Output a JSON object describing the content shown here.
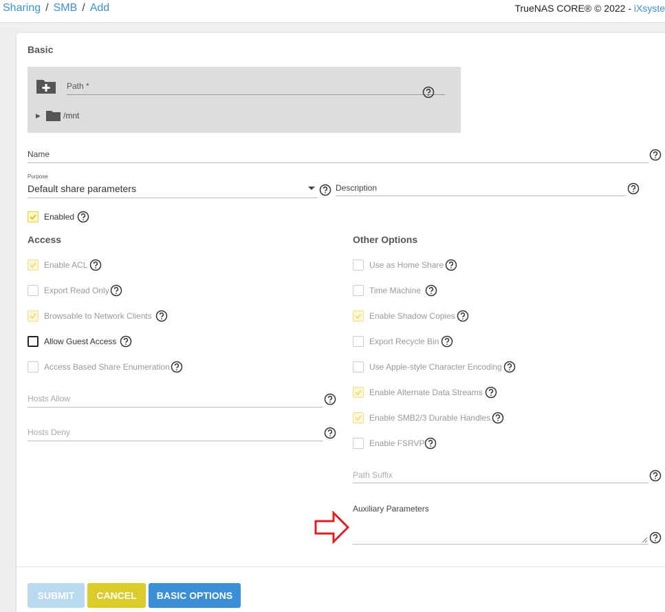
{
  "breadcrumb": {
    "items": [
      "Sharing",
      "SMB",
      "Add"
    ],
    "separator": "/"
  },
  "copyright": {
    "text": "TrueNAS CORE® © 2022 - ",
    "brand": "iXsyste"
  },
  "basic": {
    "title": "Basic",
    "path_label": "Path *",
    "tree_root": "/mnt",
    "name_label": "Name",
    "purpose_label": "Purpose",
    "purpose_value": "Default share parameters",
    "description_label": "Description",
    "enabled_label": "Enabled"
  },
  "access": {
    "title": "Access",
    "options": [
      {
        "label": "Enable ACL",
        "checked": true
      },
      {
        "label": "Export Read Only",
        "checked": false
      },
      {
        "label": "Browsable to Network Clients",
        "checked": true
      },
      {
        "label": "Allow Guest Access",
        "checked": false
      },
      {
        "label": "Access Based Share Enumeration",
        "checked": false
      }
    ],
    "hosts_allow_label": "Hosts Allow",
    "hosts_deny_label": "Hosts Deny"
  },
  "other": {
    "title": "Other Options",
    "options": [
      {
        "label": "Use as Home Share",
        "checked": false
      },
      {
        "label": "Time Machine",
        "checked": false
      },
      {
        "label": "Enable Shadow Copies",
        "checked": true
      },
      {
        "label": "Export Recycle Bin",
        "checked": false
      },
      {
        "label": "Use Apple-style Character Encoding",
        "checked": false
      },
      {
        "label": "Enable Alternate Data Streams",
        "checked": true
      },
      {
        "label": "Enable SMB2/3 Durable Handles",
        "checked": true
      },
      {
        "label": "Enable FSRVP",
        "checked": false
      }
    ],
    "path_suffix_label": "Path Suffix",
    "aux_label": "Auxiliary Parameters"
  },
  "buttons": {
    "submit": "SUBMIT",
    "cancel": "CANCEL",
    "basic_options": "BASIC OPTIONS"
  },
  "colors": {
    "accent": "#3b8fd6",
    "check": "#e5d33a",
    "cancel": "#dccc2a",
    "annotation_arrow": "#e02020"
  },
  "icons": [
    "create-folder-icon",
    "help-icon",
    "folder-icon",
    "expand-triangle-icon",
    "check-icon",
    "dropdown-arrow-icon",
    "resize-handle-icon",
    "arrow-annotation-icon"
  ]
}
